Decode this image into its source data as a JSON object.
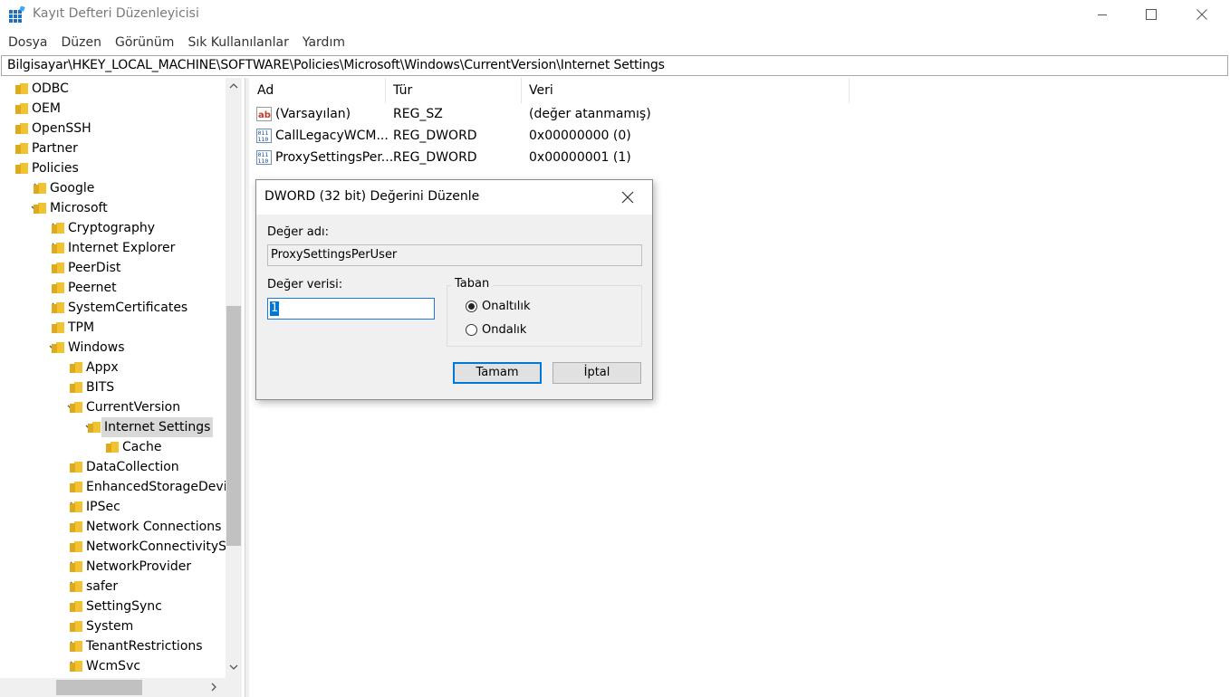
{
  "window": {
    "title": "Kayıt Defteri Düzenleyicisi"
  },
  "menu": [
    "Dosya",
    "Düzen",
    "Görünüm",
    "Sık Kullanılanlar",
    "Yardım"
  ],
  "address": "Bilgisayar\\HKEY_LOCAL_MACHINE\\SOFTWARE\\Policies\\Microsoft\\Windows\\CurrentVersion\\Internet Settings",
  "tree": [
    {
      "label": "ODBC",
      "expander": "none"
    },
    {
      "label": "OEM",
      "expander": "none"
    },
    {
      "label": "OpenSSH",
      "expander": "none"
    },
    {
      "label": "Partner",
      "expander": "none"
    },
    {
      "label": "Policies",
      "expander": "none"
    },
    {
      "label": "Google",
      "expander": "collapsed"
    },
    {
      "label": "Microsoft",
      "expander": "expanded"
    },
    {
      "label": "Cryptography",
      "expander": "collapsed"
    },
    {
      "label": "Internet Explorer",
      "expander": "collapsed"
    },
    {
      "label": "PeerDist",
      "expander": "none"
    },
    {
      "label": "Peernet",
      "expander": "none"
    },
    {
      "label": "SystemCertificates",
      "expander": "collapsed"
    },
    {
      "label": "TPM",
      "expander": "none"
    },
    {
      "label": "Windows",
      "expander": "expanded"
    },
    {
      "label": "Appx",
      "expander": "none"
    },
    {
      "label": "BITS",
      "expander": "none"
    },
    {
      "label": "CurrentVersion",
      "expander": "expanded"
    },
    {
      "label": "Internet Settings",
      "expander": "expanded",
      "selected": true
    },
    {
      "label": "Cache",
      "expander": "none"
    },
    {
      "label": "DataCollection",
      "expander": "none"
    },
    {
      "label": "EnhancedStorageDevic",
      "expander": "none"
    },
    {
      "label": "IPSec",
      "expander": "collapsed"
    },
    {
      "label": "Network Connections",
      "expander": "none"
    },
    {
      "label": "NetworkConnectivitySta",
      "expander": "none"
    },
    {
      "label": "NetworkProvider",
      "expander": "collapsed"
    },
    {
      "label": "safer",
      "expander": "collapsed"
    },
    {
      "label": "SettingSync",
      "expander": "none"
    },
    {
      "label": "System",
      "expander": "none"
    },
    {
      "label": "TenantRestrictions",
      "expander": "collapsed"
    },
    {
      "label": "WcmSvc",
      "expander": "collapsed"
    }
  ],
  "list": {
    "columns": [
      "Ad",
      "Tür",
      "Veri"
    ],
    "rows": [
      {
        "icon": "string-value-icon",
        "name": "(Varsayılan)",
        "type": "REG_SZ",
        "data": "(değer atanmamış)"
      },
      {
        "icon": "binary-value-icon",
        "name": "CallLegacyWCM...",
        "type": "REG_DWORD",
        "data": "0x00000000 (0)"
      },
      {
        "icon": "binary-value-icon",
        "name": "ProxySettingsPer...",
        "type": "REG_DWORD",
        "data": "0x00000001 (1)"
      }
    ]
  },
  "dialog": {
    "title": "DWORD (32 bit) Değerini Düzenle",
    "value_name_label": "Değer adı:",
    "value_name": "ProxySettingsPerUser",
    "value_data_label": "Değer verisi:",
    "value_data": "1",
    "base_label": "Taban",
    "hex_label": "Onaltılık",
    "dec_label": "Ondalık",
    "base_selected": "hex",
    "ok_label": "Tamam",
    "cancel_label": "İptal"
  },
  "colors": {
    "folder": "#f1c232",
    "folder_dark": "#dcaa1c",
    "accent": "#0078d7",
    "selection": "#d9d9d9"
  }
}
